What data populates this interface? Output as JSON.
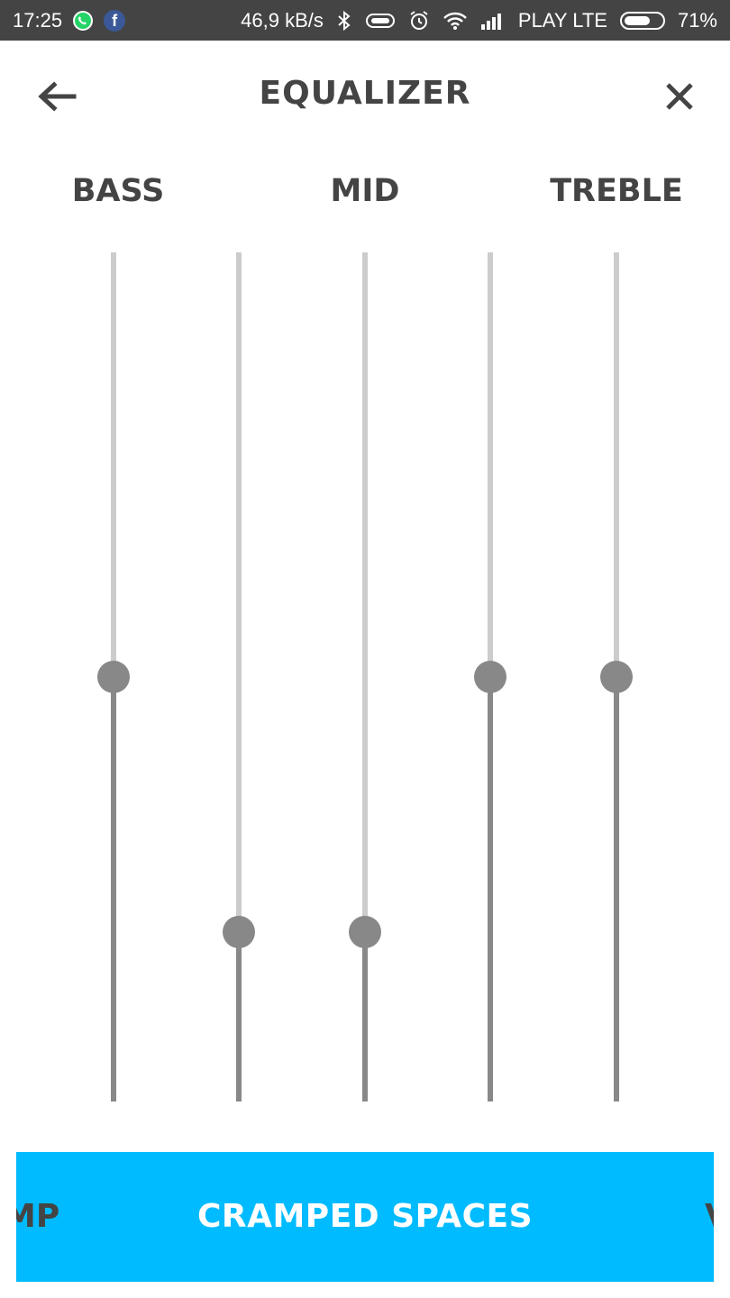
{
  "status_bar": {
    "time": "17:25",
    "net_speed": "46,9 kB/s",
    "carrier": "PLAY LTE",
    "battery": "71%",
    "battery_level": 0.71,
    "icons": [
      "whatsapp-icon",
      "facebook-icon",
      "bluetooth-icon",
      "vr-headset-icon",
      "alarm-icon",
      "wifi-icon",
      "signal-icon",
      "battery-icon"
    ]
  },
  "header": {
    "title": "EQUALIZER",
    "back_icon": "arrow-left-icon",
    "close_icon": "close-icon"
  },
  "bands": {
    "labels": [
      "BASS",
      "MID",
      "TREBLE"
    ]
  },
  "sliders": [
    {
      "level": 0.5
    },
    {
      "level": 0.2
    },
    {
      "level": 0.2
    },
    {
      "level": 0.5
    },
    {
      "level": 0.5
    }
  ],
  "presets": {
    "previous_partial": "MP",
    "current": "CRAMPED SPACES",
    "next_partial": "V"
  },
  "colors": {
    "status_bar": "#444444",
    "text": "#444444",
    "track_inactive": "#cccccc",
    "track_active": "#888888",
    "preset_bar": "#00bbff",
    "preset_text": "#ffffff"
  }
}
